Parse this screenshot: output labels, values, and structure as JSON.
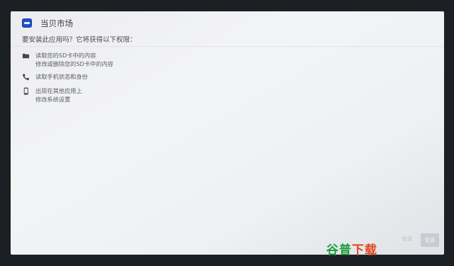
{
  "header": {
    "app_name": "当贝市场",
    "install_prompt": "要安装此应用吗？它将获得以下权限：",
    "app_icon": "blue-app-logo-icon"
  },
  "permissions": [
    {
      "icon": "folder-icon",
      "lines": [
        "读取您的SD卡中的内容",
        "修改或删除您的SD卡中的内容"
      ]
    },
    {
      "icon": "phone-icon",
      "lines": [
        "读取手机状态和身份"
      ]
    },
    {
      "icon": "mobile-device-icon",
      "lines": [
        "出现在其他应用上",
        "修改系统设置"
      ]
    }
  ],
  "actions": {
    "cancel_label": "取消",
    "install_label": "安装"
  },
  "watermark": {
    "part1": "谷普",
    "part2": "下载"
  },
  "colors": {
    "app_icon_blue": "#1e4fcf",
    "watermark_green": "#1e9b3a",
    "watermark_orange": "#e0471e"
  }
}
